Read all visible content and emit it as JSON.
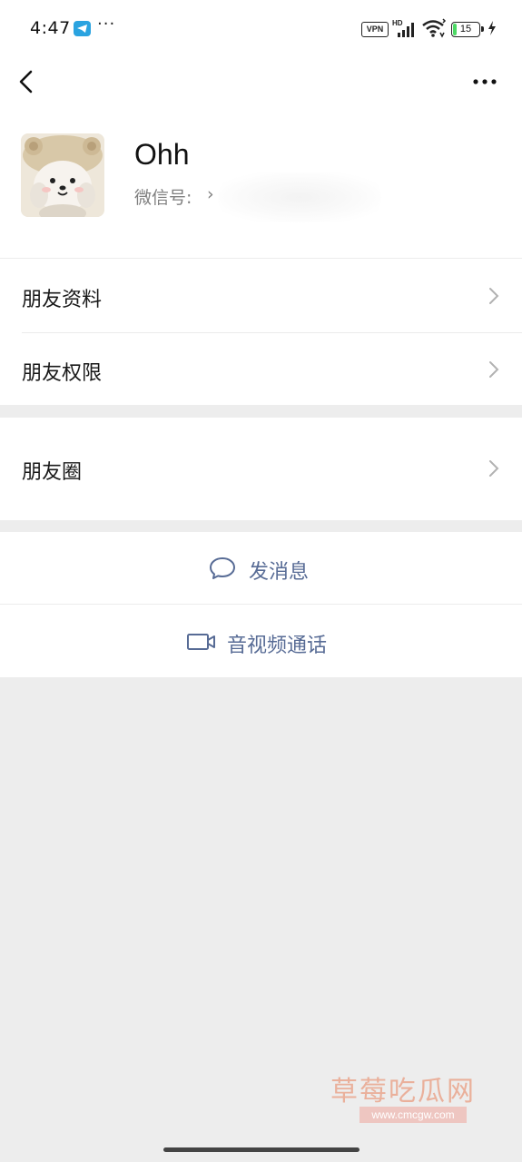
{
  "status_bar": {
    "time": "4:47",
    "more_dots": "···",
    "vpn": "VPN",
    "hd": "HD",
    "battery": "15",
    "battery_level": 0.15,
    "icons": [
      "telegram-icon",
      "signal-icon",
      "wifi-icon",
      "battery-icon",
      "charging-icon"
    ]
  },
  "nav": {
    "icons": [
      "back-icon",
      "more-icon"
    ]
  },
  "profile": {
    "nickname": "Ohh",
    "wechat_id_label": "微信号:",
    "wechat_id_value": "›"
  },
  "menu": {
    "items": [
      {
        "label": "朋友资料"
      },
      {
        "label": "朋友权限"
      },
      {
        "label": "朋友圈"
      }
    ]
  },
  "actions": {
    "message_label": "发消息",
    "call_label": "音视频通话",
    "accent_color": "#576b95"
  },
  "watermark": {
    "title": "草莓吃瓜网",
    "url": "www.cmcgw.com"
  }
}
